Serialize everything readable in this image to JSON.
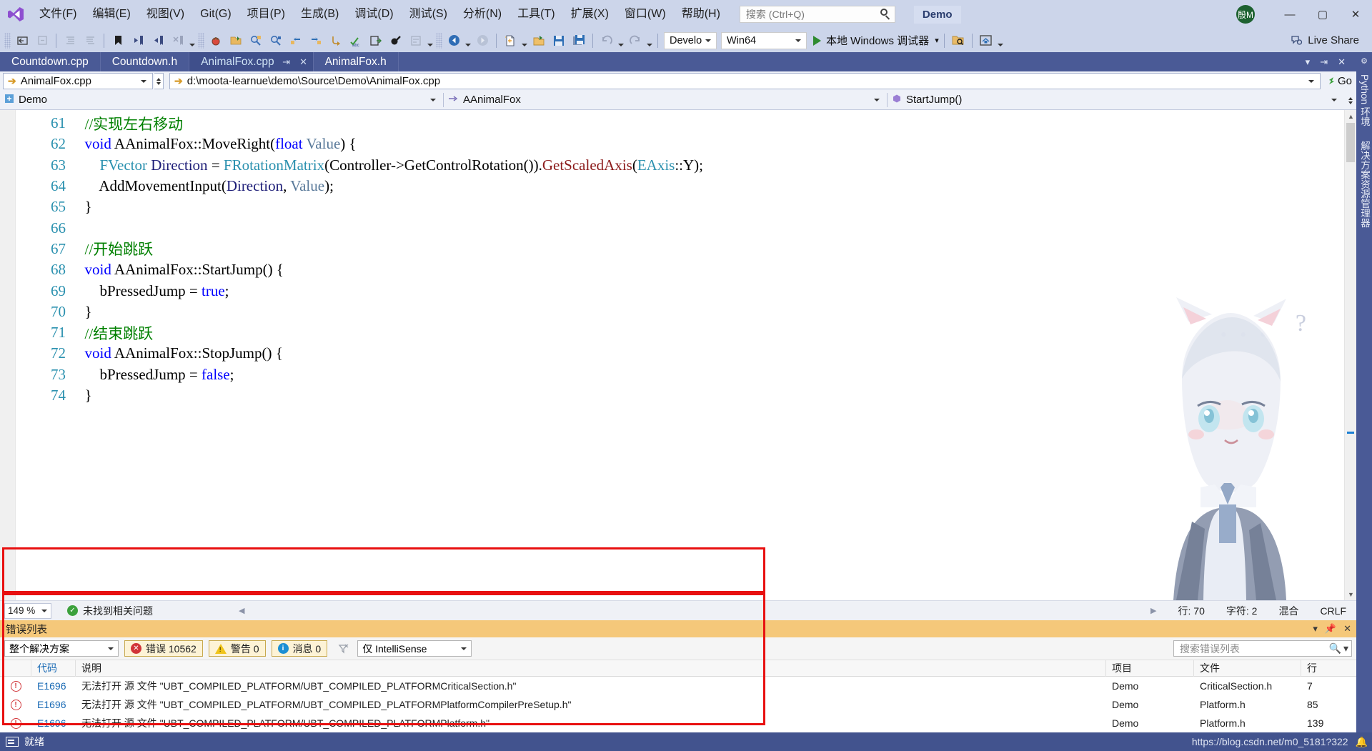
{
  "window": {
    "product_badge": "Demo",
    "avatar_initials": "殷M",
    "minimize": "—",
    "maximize": "▢",
    "close": "✕"
  },
  "menubar": {
    "logo_name": "visual-studio-logo",
    "items": [
      {
        "label": "文件(F)"
      },
      {
        "label": "编辑(E)"
      },
      {
        "label": "视图(V)"
      },
      {
        "label": "Git(G)"
      },
      {
        "label": "项目(P)"
      },
      {
        "label": "生成(B)"
      },
      {
        "label": "调试(D)"
      },
      {
        "label": "测试(S)"
      },
      {
        "label": "分析(N)"
      },
      {
        "label": "工具(T)"
      },
      {
        "label": "扩展(X)"
      },
      {
        "label": "窗口(W)"
      },
      {
        "label": "帮助(H)"
      }
    ],
    "search_placeholder": "搜索 (Ctrl+Q)"
  },
  "toolbar": {
    "config_value": "Develop",
    "platform_value": "Win64",
    "run_label": "本地 Windows 调试器",
    "live_share_label": "Live Share"
  },
  "tabs": [
    {
      "label": "Countdown.cpp",
      "active": false
    },
    {
      "label": "Countdown.h",
      "active": false
    },
    {
      "label": "AnimalFox.cpp",
      "active": true
    },
    {
      "label": "AnimalFox.h",
      "active": false
    }
  ],
  "navbar": {
    "file_combo": "AnimalFox.cpp",
    "path": "d:\\moota-learnue\\demo\\Source\\Demo\\AnimalFox.cpp",
    "go_label": "Go",
    "project_combo": "Demo",
    "class_combo": "AAnimalFox",
    "member_combo": "StartJump()"
  },
  "code": {
    "lines": [
      {
        "no": "61",
        "segments": [
          {
            "t": "  ",
            "c": ""
          },
          {
            "t": "//实现左右移动",
            "c": "cm"
          }
        ]
      },
      {
        "no": "62",
        "segments": [
          {
            "t": "  ",
            "c": ""
          },
          {
            "t": "void",
            "c": "k"
          },
          {
            "t": " AAnimalFox::MoveRight(",
            "c": ""
          },
          {
            "t": "float",
            "c": "k"
          },
          {
            "t": " ",
            "c": ""
          },
          {
            "t": "Value",
            "c": "pr"
          },
          {
            "t": ") {",
            "c": ""
          }
        ]
      },
      {
        "no": "63",
        "segments": [
          {
            "t": "      ",
            "c": ""
          },
          {
            "t": "FVector",
            "c": "ty"
          },
          {
            "t": " ",
            "c": ""
          },
          {
            "t": "Direction",
            "c": "lv"
          },
          {
            "t": " = ",
            "c": ""
          },
          {
            "t": "FRotationMatrix",
            "c": "ty"
          },
          {
            "t": "(Controller->GetControlRotation()).",
            "c": ""
          },
          {
            "t": "GetScaledAxis",
            "c": "fn"
          },
          {
            "t": "(",
            "c": ""
          },
          {
            "t": "EAxis",
            "c": "ty"
          },
          {
            "t": "::Y);",
            "c": ""
          }
        ]
      },
      {
        "no": "64",
        "segments": [
          {
            "t": "      AddMovementInput(",
            "c": ""
          },
          {
            "t": "Direction",
            "c": "lv"
          },
          {
            "t": ", ",
            "c": ""
          },
          {
            "t": "Value",
            "c": "pr"
          },
          {
            "t": ");",
            "c": ""
          }
        ]
      },
      {
        "no": "65",
        "segments": [
          {
            "t": "  }",
            "c": ""
          }
        ]
      },
      {
        "no": "66",
        "segments": [
          {
            "t": "",
            "c": ""
          }
        ]
      },
      {
        "no": "67",
        "segments": [
          {
            "t": "  ",
            "c": ""
          },
          {
            "t": "//开始跳跃",
            "c": "cm"
          }
        ]
      },
      {
        "no": "68",
        "segments": [
          {
            "t": "  ",
            "c": ""
          },
          {
            "t": "void",
            "c": "k"
          },
          {
            "t": " AAnimalFox::StartJump() {",
            "c": ""
          }
        ]
      },
      {
        "no": "69",
        "segments": [
          {
            "t": "      bPressedJump = ",
            "c": ""
          },
          {
            "t": "true",
            "c": "k"
          },
          {
            "t": ";",
            "c": ""
          }
        ]
      },
      {
        "no": "70",
        "segments": [
          {
            "t": "  }",
            "c": ""
          }
        ]
      },
      {
        "no": "71",
        "segments": [
          {
            "t": "  ",
            "c": ""
          },
          {
            "t": "//结束跳跃",
            "c": "cm"
          }
        ]
      },
      {
        "no": "72",
        "segments": [
          {
            "t": "  ",
            "c": ""
          },
          {
            "t": "void",
            "c": "k"
          },
          {
            "t": " AAnimalFox::StopJump() {",
            "c": ""
          }
        ]
      },
      {
        "no": "73",
        "segments": [
          {
            "t": "      bPressedJump = ",
            "c": ""
          },
          {
            "t": "false",
            "c": "k"
          },
          {
            "t": ";",
            "c": ""
          }
        ]
      },
      {
        "no": "74",
        "segments": [
          {
            "t": "  }",
            "c": ""
          }
        ]
      }
    ]
  },
  "editor_status": {
    "zoom": "149 %",
    "issues": "未找到相关问题",
    "line": "行: 70",
    "col": "字符: 2",
    "encoding": "混合",
    "eol": "CRLF"
  },
  "error_list": {
    "title": "错误列表",
    "scope": "整个解决方案",
    "errors_label": "错误 10562",
    "warnings_label": "警告 0",
    "messages_label": "消息 0",
    "filter_value": "仅 IntelliSense",
    "search_placeholder": "搜索错误列表",
    "columns": [
      "",
      "代码",
      "说明",
      "项目",
      "文件",
      "行"
    ],
    "rows": [
      {
        "code": "E1696",
        "desc": "无法打开 源 文件 \"UBT_COMPILED_PLATFORM/UBT_COMPILED_PLATFORMCriticalSection.h\"",
        "project": "Demo",
        "file": "CriticalSection.h",
        "line": "7"
      },
      {
        "code": "E1696",
        "desc": "无法打开 源 文件 \"UBT_COMPILED_PLATFORM/UBT_COMPILED_PLATFORMPlatformCompilerPreSetup.h\"",
        "project": "Demo",
        "file": "Platform.h",
        "line": "85"
      },
      {
        "code": "E1696",
        "desc": "无法打开 源 文件 \"UBT_COMPILED_PLATFORM/UBT_COMPILED_PLATFORMPlatform.h\"",
        "project": "Demo",
        "file": "Platform.h",
        "line": "139"
      }
    ]
  },
  "right_dock": {
    "tabs": [
      "Python 环境",
      "解决方案资源管理器"
    ]
  },
  "statusbar": {
    "state": "就绪",
    "watermark": "https://blog.csdn.net/m0_5181?322"
  },
  "colors": {
    "chrome": "#ccd5ea",
    "tabstrip": "#4a5a96",
    "statusbar": "#42538e",
    "error_header": "#f5c87a",
    "highlight_box": "#e81010",
    "accent_blue": "#2b91af"
  }
}
